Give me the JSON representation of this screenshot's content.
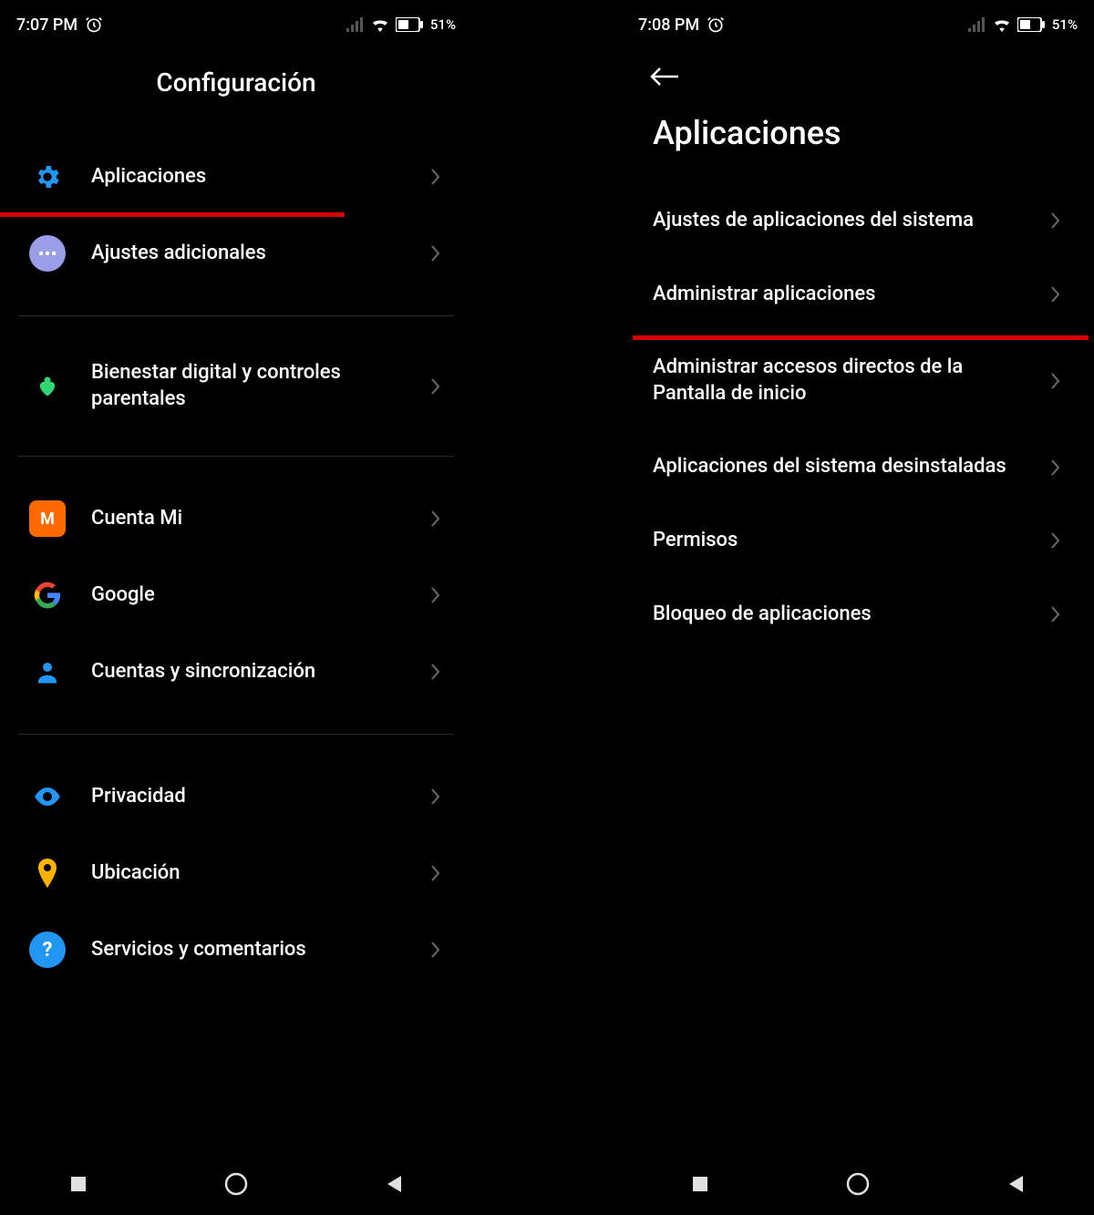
{
  "screen1": {
    "status": {
      "time": "7:07 PM",
      "battery": "51%"
    },
    "title": "Configuración",
    "items": [
      {
        "label": "Aplicaciones",
        "icon": "gear",
        "color": "#2196f3",
        "highlight": true
      },
      {
        "label": "Ajustes adicionales",
        "icon": "dots",
        "color": "#9a9ee8"
      },
      {
        "divider": true
      },
      {
        "label": "Bienestar digital y controles parentales",
        "icon": "heart",
        "color": "#2fd671"
      },
      {
        "divider": true
      },
      {
        "label": "Cuenta Mi",
        "icon": "mi",
        "color": "#ff6900"
      },
      {
        "label": "Google",
        "icon": "google"
      },
      {
        "label": "Cuentas y sincronización",
        "icon": "person",
        "color": "#2196f3"
      },
      {
        "divider": true
      },
      {
        "label": "Privacidad",
        "icon": "eye",
        "color": "#2196f3"
      },
      {
        "label": "Ubicación",
        "icon": "pin",
        "color": "#ffb300"
      },
      {
        "label": "Servicios y comentarios",
        "icon": "help",
        "color": "#2196f3"
      }
    ]
  },
  "screen2": {
    "status": {
      "time": "7:08 PM",
      "battery": "51%"
    },
    "title": "Aplicaciones",
    "items": [
      {
        "label": "Ajustes de aplicaciones del sistema"
      },
      {
        "label": "Administrar aplicaciones",
        "highlight": true
      },
      {
        "label": "Administrar accesos directos de la Pantalla de inicio"
      },
      {
        "label": "Aplicaciones del sistema desinstaladas"
      },
      {
        "label": "Permisos"
      },
      {
        "label": "Bloqueo de aplicaciones"
      }
    ]
  }
}
